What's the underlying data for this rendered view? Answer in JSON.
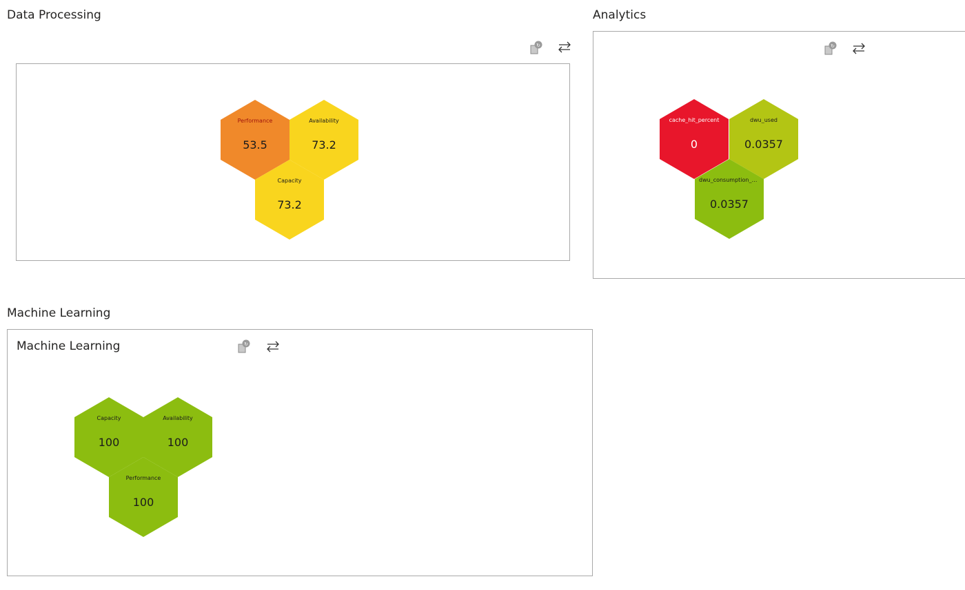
{
  "colors": {
    "orange": "#f0892a",
    "yellow": "#f9d51e",
    "red": "#e8162b",
    "olive": "#b3c514",
    "green": "#8cbd10"
  },
  "sections": {
    "data_processing": {
      "title": "Data Processing"
    },
    "analytics": {
      "title": "Analytics"
    },
    "machine_learning": {
      "title": "Machine Learning",
      "panel_title": "Machine Learning"
    }
  },
  "toolbar": {
    "refresh_icon": "refresh-data-icon",
    "swap_icon": "swap-arrows-icon"
  },
  "tiles": {
    "dp": [
      {
        "label": "Performance",
        "value": "53.5",
        "color": "orange"
      },
      {
        "label": "Availability",
        "value": "73.2",
        "color": "yellow"
      },
      {
        "label": "Capacity",
        "value": "73.2",
        "color": "yellow"
      }
    ],
    "an": [
      {
        "label": "cache_hit_percent",
        "value": "0",
        "color": "red"
      },
      {
        "label": "dwu_used",
        "value": "0.0357",
        "color": "olive"
      },
      {
        "label": "dwu_consumption_pe...",
        "value": "0.0357",
        "color": "green"
      }
    ],
    "ml": [
      {
        "label": "Capacity",
        "value": "100",
        "color": "green"
      },
      {
        "label": "Availability",
        "value": "100",
        "color": "green"
      },
      {
        "label": "Performance",
        "value": "100",
        "color": "green"
      }
    ]
  }
}
